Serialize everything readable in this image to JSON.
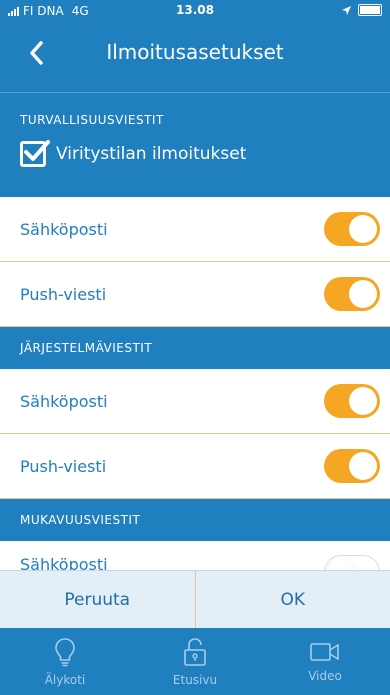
{
  "status_bar": {
    "carrier": "FI DNA",
    "network": "4G",
    "time": "13.08"
  },
  "header": {
    "back_icon": "chevron-left-icon",
    "title": "Ilmoitusasetukset"
  },
  "sections": {
    "security": {
      "heading": "TURVALLISUUSVIESTIT",
      "checkbox_label": "Viritystilan ilmoitukset",
      "checkbox_checked": true,
      "rows": [
        {
          "label": "Sähköposti",
          "enabled": true
        },
        {
          "label": "Push-viesti",
          "enabled": true
        }
      ]
    },
    "system": {
      "heading": "JÄRJESTELMÄVIESTIT",
      "rows": [
        {
          "label": "Sähköposti",
          "enabled": true
        },
        {
          "label": "Push-viesti",
          "enabled": true
        }
      ]
    },
    "comfort": {
      "heading": "MUKAVUUSVIESTIT",
      "rows": [
        {
          "label": "Sähköposti",
          "enabled": false
        }
      ]
    }
  },
  "actions": {
    "cancel": "Peruuta",
    "ok": "OK"
  },
  "tabs": [
    {
      "label": "Älykoti",
      "icon": "lightbulb-icon"
    },
    {
      "label": "Etusivu",
      "icon": "unlocked-padlock-icon"
    },
    {
      "label": "Video",
      "icon": "video-camera-icon"
    }
  ],
  "colors": {
    "primary_blue": "#1f7fbf",
    "toggle_on": "#f5a623",
    "tab_inactive": "#a8cde9",
    "button_bar": "#e4eef6"
  }
}
